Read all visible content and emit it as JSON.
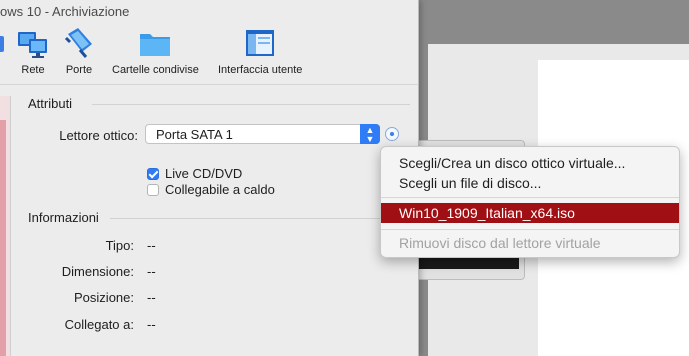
{
  "window": {
    "title": "ows 10 - Archiviazione"
  },
  "toolbar": {
    "items": [
      {
        "label": "Rete",
        "icon": "network-icon"
      },
      {
        "label": "Porte",
        "icon": "ports-icon"
      },
      {
        "label": "Cartelle condivise",
        "icon": "folder-icon"
      },
      {
        "label": "Interfaccia utente",
        "icon": "user-interface-icon"
      }
    ]
  },
  "attributes": {
    "section_title": "Attributi",
    "optical_drive_label": "Lettore ottico:",
    "optical_drive_value": "Porta SATA 1",
    "live_cd_label": "Live CD/DVD",
    "live_cd_checked": true,
    "hotplug_label": "Collegabile a caldo",
    "hotplug_checked": false
  },
  "information": {
    "section_title": "Informazioni",
    "rows": [
      {
        "label": "Tipo:",
        "value": "--"
      },
      {
        "label": "Dimensione:",
        "value": "--"
      },
      {
        "label": "Posizione:",
        "value": "--"
      },
      {
        "label": "Collegato a:",
        "value": "--"
      }
    ]
  },
  "menu": {
    "items": [
      {
        "label": "Scegli/Crea un disco ottico virtuale...",
        "state": "normal"
      },
      {
        "label": "Scegli un file di disco...",
        "state": "normal"
      },
      {
        "label": "Win10_1909_Italian_x64.iso",
        "state": "selected"
      },
      {
        "label": "Rimuovi disco dal lettore virtuale",
        "state": "disabled"
      }
    ]
  },
  "colors": {
    "accent": "#2f7cf6",
    "menu_selected": "#a00f13"
  }
}
